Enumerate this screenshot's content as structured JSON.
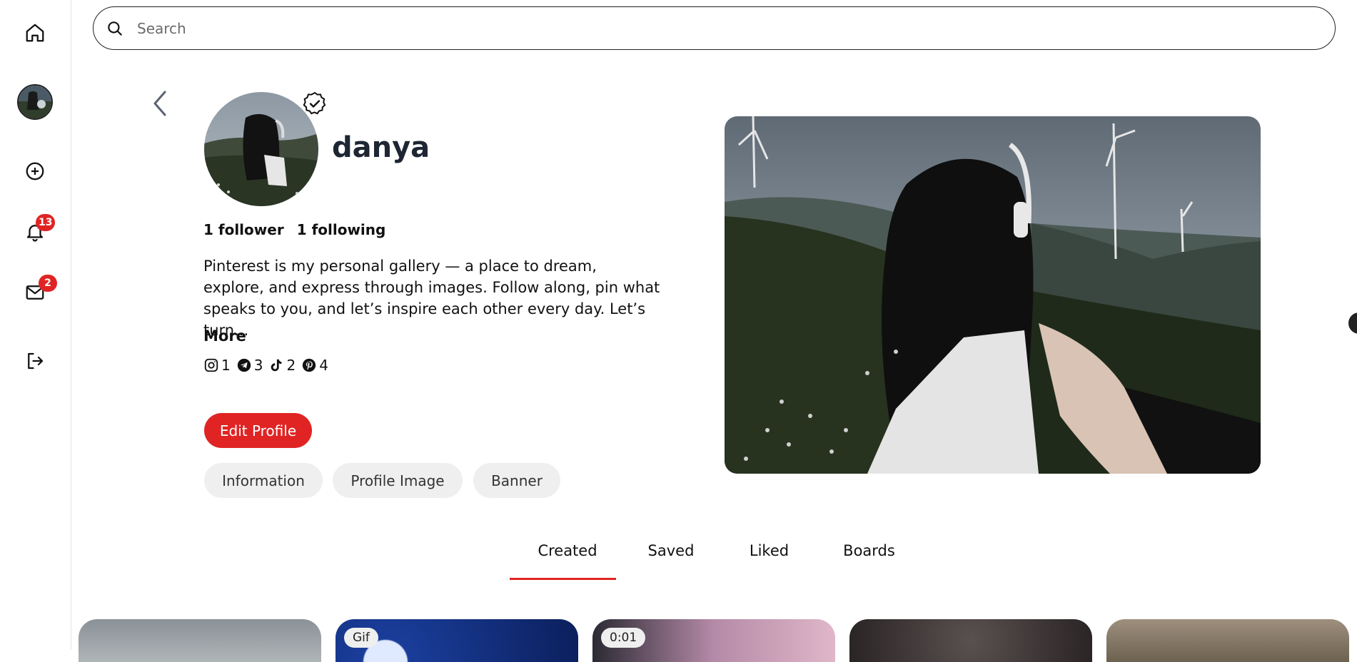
{
  "sidebar": {
    "items": [
      {
        "name": "home-button",
        "icon": "home-icon"
      },
      {
        "name": "profile-avatar",
        "icon": "avatar"
      },
      {
        "name": "create-button",
        "icon": "plus-circle-icon"
      },
      {
        "name": "notifications-button",
        "icon": "bell-icon",
        "badge": "13"
      },
      {
        "name": "messages-button",
        "icon": "mail-icon",
        "badge": "2"
      },
      {
        "name": "logout-button",
        "icon": "logout-icon"
      }
    ],
    "notifications_badge": "13",
    "messages_badge": "2"
  },
  "search": {
    "placeholder": "Search",
    "value": ""
  },
  "profile": {
    "username": "danya",
    "followers": "1 follower",
    "following": "1 following",
    "bio": "Pinterest is my personal gallery — a place to dream, explore, and express through images. Follow along, pin what speaks to you, and let’s inspire each other every day. Let’s turn...",
    "more_label": "More",
    "socials": [
      {
        "icon": "instagram-icon",
        "count": "1"
      },
      {
        "icon": "telegram-icon",
        "count": "3"
      },
      {
        "icon": "tiktok-icon",
        "count": "2"
      },
      {
        "icon": "pinterest-icon",
        "count": "4"
      }
    ],
    "edit_label": "Edit Profile",
    "pills": [
      "Information",
      "Profile Image",
      "Banner"
    ]
  },
  "tabs": {
    "items": [
      "Created",
      "Saved",
      "Liked",
      "Boards"
    ],
    "active": "Created"
  },
  "grid": {
    "cards": [
      {
        "label": ""
      },
      {
        "label": "Gif"
      },
      {
        "label": "0:01"
      },
      {
        "label": ""
      },
      {
        "label": ""
      }
    ]
  },
  "colors": {
    "accent": "#e02424",
    "pill_bg": "#efefef",
    "text_dark": "#1e2533"
  }
}
